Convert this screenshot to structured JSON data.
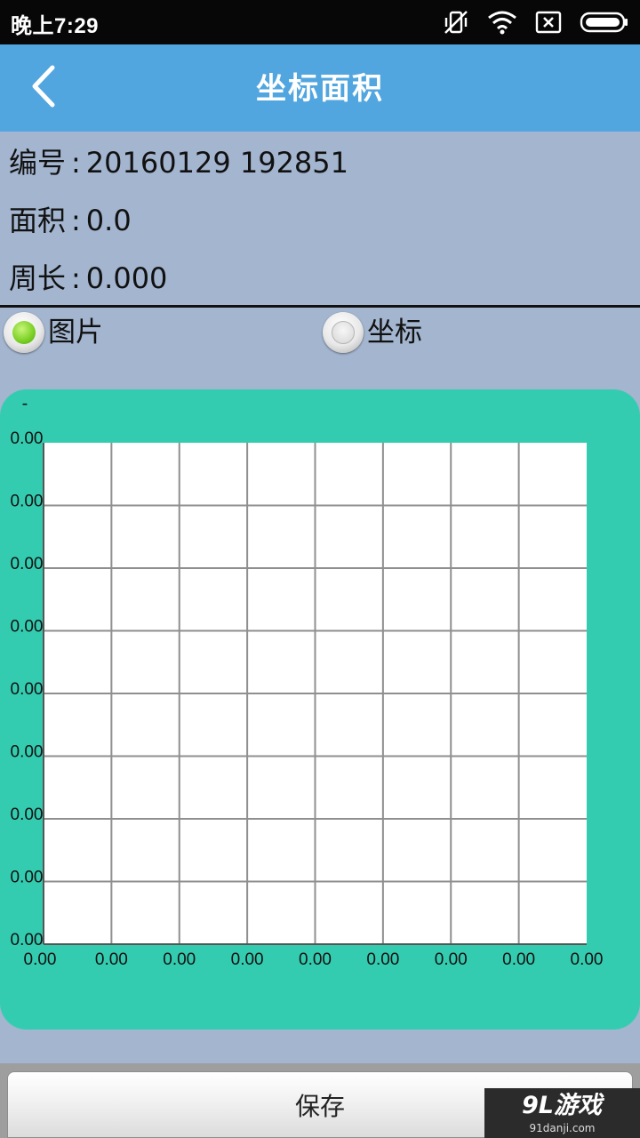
{
  "status_bar": {
    "time": "晚上7:29",
    "icons": [
      "vibrate-off-icon",
      "wifi-icon",
      "sim-none-icon",
      "battery-icon"
    ]
  },
  "header": {
    "title": "坐标面积",
    "back_icon": "chevron-left-icon"
  },
  "info": {
    "id_label": "编号",
    "id_value": "20160129 192851",
    "area_label": "面积",
    "area_value": "0.0",
    "perimeter_label": "周长",
    "perimeter_value": "0.000",
    "separator": ":"
  },
  "view_mode": {
    "options": [
      {
        "label": "图片",
        "selected": true
      },
      {
        "label": "坐标",
        "selected": false
      }
    ]
  },
  "chart_data": {
    "type": "scatter",
    "title": "-",
    "xlabel": "",
    "ylabel": "",
    "grid": true,
    "grid_columns": 8,
    "grid_rows": 8,
    "x_tick_labels": [
      "0.00",
      "0.00",
      "0.00",
      "0.00",
      "0.00",
      "0.00",
      "0.00",
      "0.00",
      "0.00"
    ],
    "y_tick_labels": [
      "0.00",
      "0.00",
      "0.00",
      "0.00",
      "0.00",
      "0.00",
      "0.00",
      "0.00",
      "0.00"
    ],
    "xlim": [
      0,
      0
    ],
    "ylim": [
      0,
      0
    ],
    "points": [],
    "colors": {
      "card": "#34ccb0",
      "plot": "#ffffff",
      "grid": "#8f8f8f"
    }
  },
  "actions": {
    "save_label": "保存"
  },
  "watermark": {
    "logo": "9L游戏",
    "url": "91danji.com"
  },
  "colors": {
    "title_bar": "#52a6df",
    "background": "#a3b5cf",
    "accent_green": "#79cf23"
  }
}
